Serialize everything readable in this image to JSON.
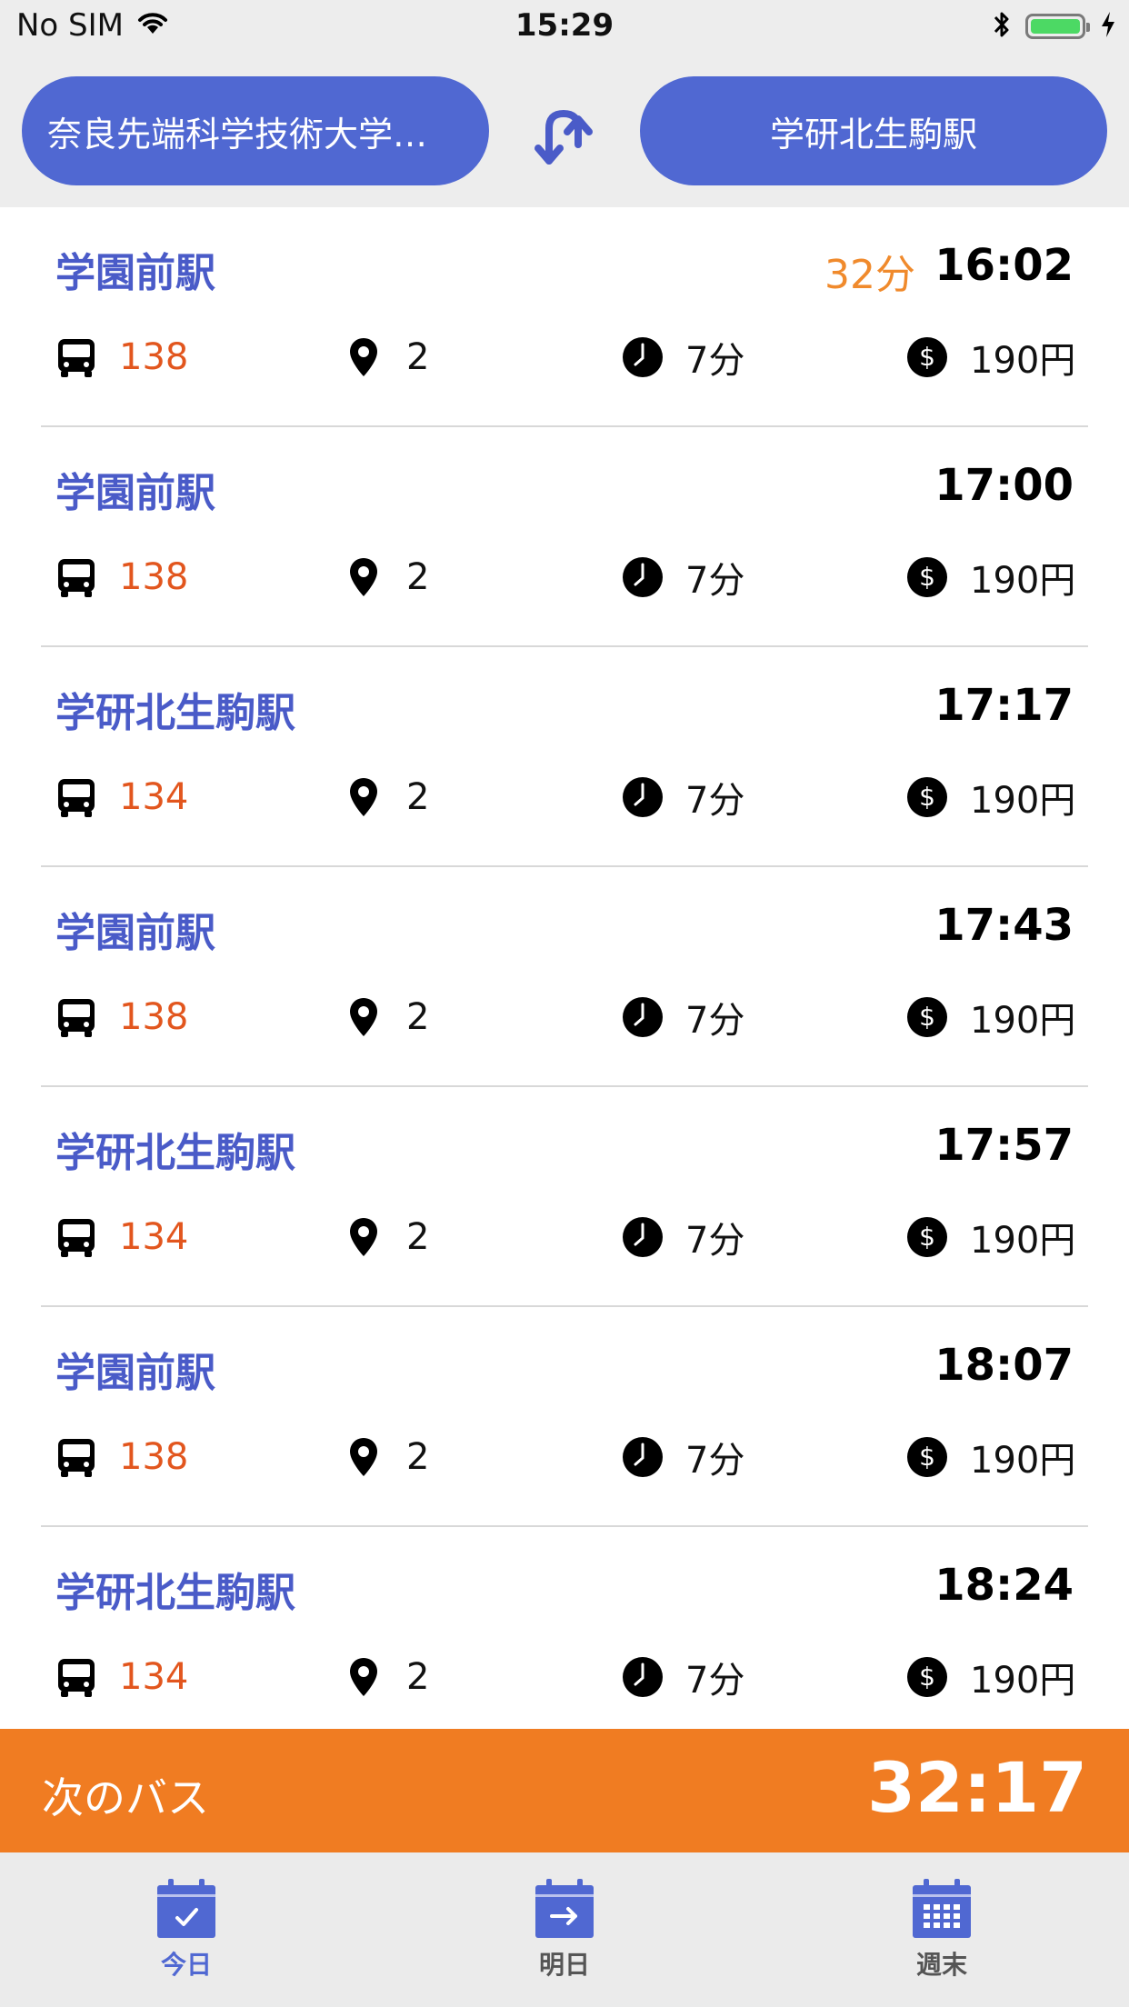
{
  "status_bar": {
    "carrier": "No SIM",
    "time": "15:29"
  },
  "header": {
    "from_station": "奈良先端科学技術大学…",
    "to_station": "学研北生駒駅"
  },
  "departures": [
    {
      "destination": "学園前駅",
      "countdown": "32分",
      "time": "16:02",
      "route": "138",
      "stops": "2",
      "duration": "7分",
      "fare": "190円"
    },
    {
      "destination": "学園前駅",
      "countdown": "",
      "time": "17:00",
      "route": "138",
      "stops": "2",
      "duration": "7分",
      "fare": "190円"
    },
    {
      "destination": "学研北生駒駅",
      "countdown": "",
      "time": "17:17",
      "route": "134",
      "stops": "2",
      "duration": "7分",
      "fare": "190円"
    },
    {
      "destination": "学園前駅",
      "countdown": "",
      "time": "17:43",
      "route": "138",
      "stops": "2",
      "duration": "7分",
      "fare": "190円"
    },
    {
      "destination": "学研北生駒駅",
      "countdown": "",
      "time": "17:57",
      "route": "134",
      "stops": "2",
      "duration": "7分",
      "fare": "190円"
    },
    {
      "destination": "学園前駅",
      "countdown": "",
      "time": "18:07",
      "route": "138",
      "stops": "2",
      "duration": "7分",
      "fare": "190円"
    },
    {
      "destination": "学研北生駒駅",
      "countdown": "",
      "time": "18:24",
      "route": "134",
      "stops": "2",
      "duration": "7分",
      "fare": "190円"
    }
  ],
  "next_bus": {
    "label": "次のバス",
    "countdown": "32:17"
  },
  "tabs": [
    {
      "label": "今日",
      "icon": "calendar-check-icon",
      "selected": true
    },
    {
      "label": "明日",
      "icon": "calendar-arrow-icon",
      "selected": false
    },
    {
      "label": "週末",
      "icon": "calendar-grid-icon",
      "selected": false
    }
  ],
  "colors": {
    "accent_blue": "#5068d2",
    "destination_blue": "#4a5bc8",
    "route_orange": "#e2561e",
    "next_bar_orange": "#f07c22",
    "countdown_orange": "#f08a2c"
  }
}
